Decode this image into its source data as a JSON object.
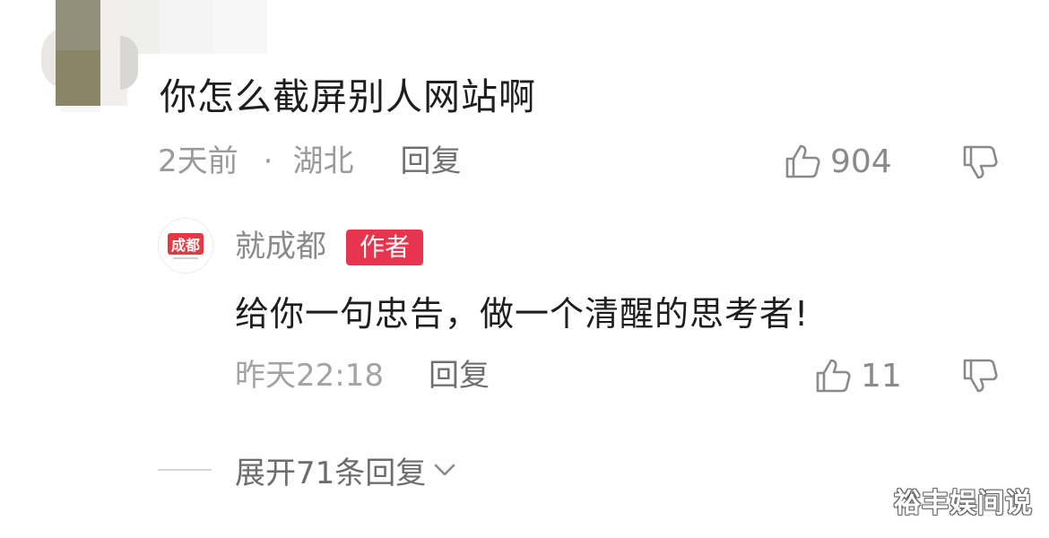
{
  "comment": {
    "text": "你怎么截屏别人网站啊",
    "time": "2天前",
    "separator": "·",
    "location": "湖北",
    "reply_label": "回复",
    "like_count": "904"
  },
  "reply": {
    "author": "就成都",
    "author_badge": "作者",
    "avatar_logo": "成都",
    "text": "给你一句忠告，做一个清醒的思考者!",
    "time": "昨天22:18",
    "reply_label": "回复",
    "like_count": "11"
  },
  "expand": {
    "label": "展开71条回复"
  },
  "watermark": "裕丰娱间说",
  "icons": {
    "like": "thumbs-up-icon",
    "dislike": "thumbs-down-icon",
    "expand": "chevron-down-icon"
  },
  "colors": {
    "author_badge": "#e8354f",
    "text": "#1e1e1e",
    "meta": "#9a9a9a"
  }
}
